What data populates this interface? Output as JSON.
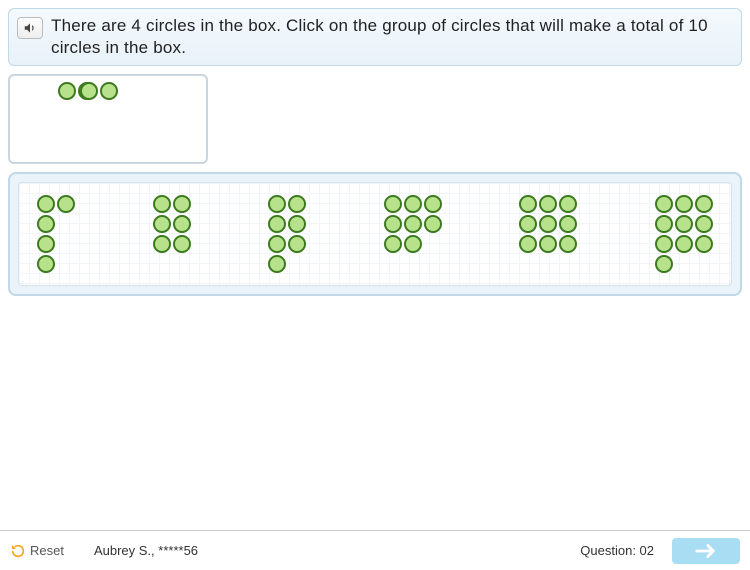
{
  "instruction": "There are 4 circles in the box. Click on the group of circles that will make a total of 10 circles in the box.",
  "box": {
    "circles": 4,
    "layout": [
      [
        1,
        1
      ],
      [
        1,
        1
      ]
    ]
  },
  "options": [
    {
      "count": 5,
      "layout": [
        [
          1,
          1
        ],
        [
          1,
          0
        ],
        [
          1,
          0
        ],
        [
          1,
          0
        ]
      ]
    },
    {
      "count": 6,
      "layout": [
        [
          1,
          1
        ],
        [
          1,
          1
        ],
        [
          1,
          1
        ]
      ]
    },
    {
      "count": 7,
      "layout": [
        [
          1,
          1
        ],
        [
          1,
          1
        ],
        [
          1,
          1
        ],
        [
          1,
          0
        ]
      ]
    },
    {
      "count": 8,
      "layout": [
        [
          1,
          1,
          1
        ],
        [
          1,
          1,
          1
        ],
        [
          1,
          1,
          0
        ]
      ]
    },
    {
      "count": 9,
      "layout": [
        [
          1,
          1,
          1
        ],
        [
          1,
          1,
          1
        ],
        [
          1,
          1,
          1
        ]
      ]
    },
    {
      "count": 10,
      "layout": [
        [
          1,
          1,
          1
        ],
        [
          1,
          1,
          1
        ],
        [
          1,
          1,
          1
        ],
        [
          1,
          0,
          0
        ]
      ]
    }
  ],
  "footer": {
    "reset": "Reset",
    "student": "Aubrey S., *****56",
    "question_label": "Question: 02"
  }
}
